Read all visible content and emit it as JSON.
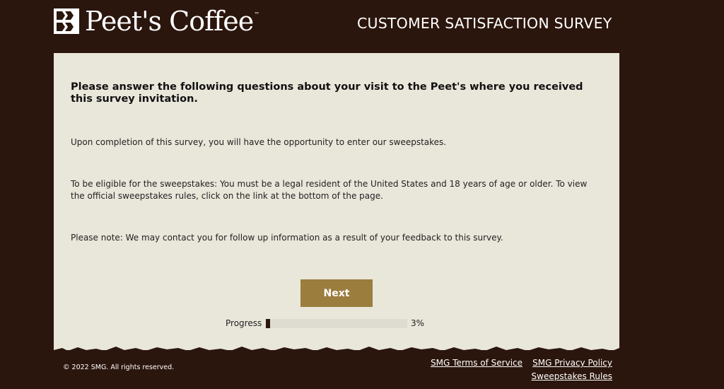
{
  "header": {
    "brand": "Peet's Coffee",
    "title": "CUSTOMER SATISFACTION SURVEY"
  },
  "intro": {
    "heading": "Please answer the following questions about your visit to the Peet's where you received this survey invitation.",
    "paragraphs": [
      "Upon completion of this survey, you will have the opportunity to enter our sweepstakes.",
      "To be eligible for the sweepstakes: You must be a legal resident of the United States and 18 years of age or older. To view the official sweepstakes rules, click on the link at the bottom of the page.",
      "Please note: We may contact you for follow up information as a result of your feedback to this survey."
    ]
  },
  "actions": {
    "next_label": "Next"
  },
  "progress": {
    "label": "Progress",
    "value_text": "3%",
    "fraction": 0.03
  },
  "footer": {
    "copyright": "© 2022 SMG. All rights reserved.",
    "links": {
      "terms": "SMG Terms of Service",
      "privacy": "SMG Privacy Policy",
      "rules": "Sweepstakes Rules"
    }
  },
  "colors": {
    "background": "#2b160d",
    "panel": "#e9e6da",
    "accent": "#9b7d3e"
  }
}
